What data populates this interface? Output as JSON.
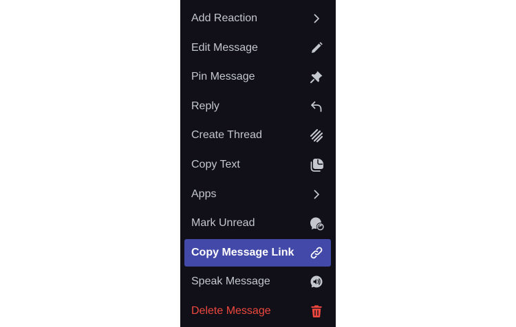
{
  "context_menu": {
    "items": [
      {
        "label": "Add Reaction",
        "icon": "chevron-right-icon"
      },
      {
        "label": "Edit Message",
        "icon": "pencil-icon"
      },
      {
        "label": "Pin Message",
        "icon": "pin-icon"
      },
      {
        "label": "Reply",
        "icon": "reply-arrow-icon"
      },
      {
        "label": "Create Thread",
        "icon": "thread-icon"
      },
      {
        "label": "Copy Text",
        "icon": "copy-text-icon"
      },
      {
        "label": "Apps",
        "icon": "chevron-right-icon"
      },
      {
        "label": "Mark Unread",
        "icon": "mark-unread-icon"
      },
      {
        "label": "Copy Message Link",
        "icon": "link-icon",
        "state": "highlighted"
      },
      {
        "label": "Speak Message",
        "icon": "speak-icon"
      },
      {
        "label": "Delete Message",
        "icon": "trash-icon",
        "state": "danger"
      }
    ]
  },
  "colors": {
    "menu_background": "#111018",
    "text": "#c4c7ce",
    "highlight_background": "#4349a8",
    "highlight_text": "#ffffff",
    "danger": "#f0483e"
  }
}
